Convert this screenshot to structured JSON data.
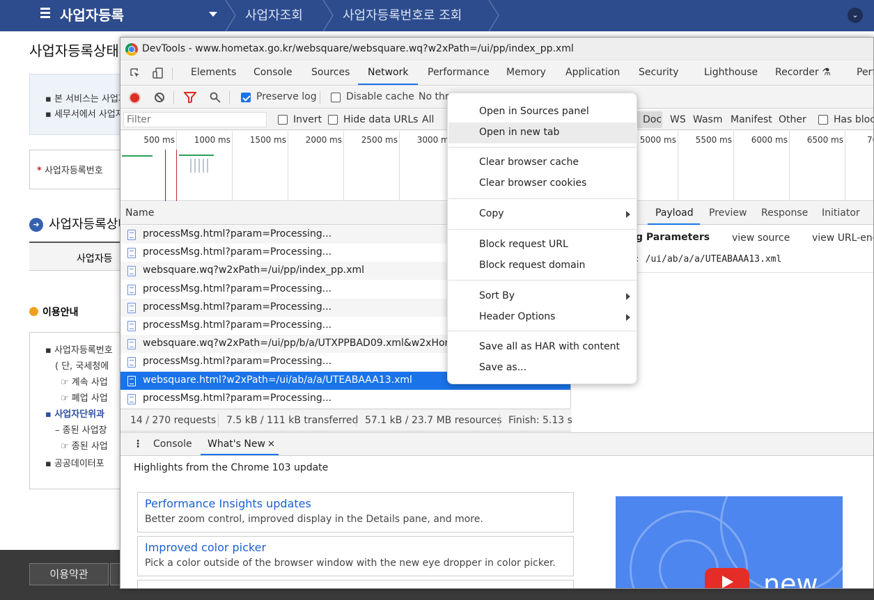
{
  "hometax": {
    "menu_title": "사업자등록",
    "breadcrumb": [
      "사업자조회",
      "사업자등록번호로 조회"
    ],
    "page_title": "사업자등록상태",
    "notice_lines": [
      "▪ 본 서비스는 사업자",
      "▪ 세무서에서 사업자"
    ],
    "reg_label": "사업자등록번호",
    "section_title": "사업자등록상태",
    "table_header": "사업자등",
    "guide_title": "이용안내",
    "guide_lines": [
      "▪ 사업자등록번호",
      "( 단, 국세청에",
      "☞ 계속 사업",
      "☞ 폐업 사업",
      "▪ 사업자단위과",
      "– 종된 사업장",
      "☞ 종된 사업",
      "▪ 공공데이터포"
    ],
    "footer_buttons": [
      "이용약관",
      ""
    ]
  },
  "devtools": {
    "window_title": "DevTools - www.hometax.go.kr/websquare/websquare.wq?w2xPath=/ui/pp/index_pp.xml",
    "panel_tabs": [
      "Elements",
      "Console",
      "Sources",
      "Network",
      "Performance",
      "Memory",
      "Application",
      "Security",
      "Lighthouse",
      "Recorder ⚗",
      "Perf"
    ],
    "active_tab": "Network",
    "toolbar": {
      "preserve_log": "Preserve log",
      "disable_cache": "Disable cache",
      "throttle": "No thr"
    },
    "filter": {
      "placeholder": "Filter",
      "invert": "Invert",
      "hide_data_urls": "Hide data URLs",
      "all": "All",
      "types": [
        "Doc",
        "WS",
        "Wasm",
        "Manifest",
        "Other"
      ],
      "has_blocked": "Has bloc"
    },
    "timeline_ticks": [
      "500 ms",
      "1000 ms",
      "1500 ms",
      "2000 ms",
      "2500 ms",
      "3000 ms",
      "5000 ms",
      "5500 ms",
      "6000 ms",
      "6500 ms",
      "70"
    ],
    "grid": {
      "name_header": "Name",
      "rows": [
        "processMsg.html?param=Processing...",
        "processMsg.html?param=Processing...",
        "websquare.wq?w2xPath=/ui/pp/index_pp.xml",
        "processMsg.html?param=Processing...",
        "processMsg.html?param=Processing...",
        "processMsg.html?param=Processing...",
        "websquare.wq?w2xPath=/ui/pp/b/a/UTXPPBAD09.xml&w2xHome",
        "processMsg.html?param=Processing...",
        "websquare.html?w2xPath=/ui/ab/a/a/UTEABAAA13.xml",
        "processMsg.html?param=Processing..."
      ],
      "selected_index": 8
    },
    "status": {
      "requests": "14 / 270 requests",
      "transferred": "7.5 kB / 111 kB transferred",
      "resources": "57.1 kB / 23.7 MB resources",
      "finish": "Finish: 5.13 s"
    },
    "details": {
      "tabs": [
        "Payload",
        "Preview",
        "Response",
        "Initiator"
      ],
      "active_tab": "Payload",
      "section_title": "g Parameters",
      "view_source": "view source",
      "view_url_encoded": "view URL-enc",
      "param_value": ": /ui/ab/a/a/UTEABAAA13.xml"
    },
    "drawer": {
      "tabs": [
        "Console",
        "What's New"
      ],
      "close_glyph": "✕",
      "headline": "Highlights from the Chrome 103 update",
      "cards": [
        {
          "title": "Performance Insights updates",
          "desc": "Better zoom control, improved display in the Details pane, and more."
        },
        {
          "title": "Improved color picker",
          "desc": "Pick a color outside of the browser window with the new eye dropper in color picker."
        }
      ],
      "promo_text": "new"
    }
  },
  "context_menu": {
    "items": [
      {
        "label": "Open in Sources panel"
      },
      {
        "label": "Open in new tab"
      },
      {
        "label": "Clear browser cache"
      },
      {
        "label": "Clear browser cookies"
      },
      {
        "label": "Copy"
      },
      {
        "label": "Block request URL"
      },
      {
        "label": "Block request domain"
      },
      {
        "label": "Sort By"
      },
      {
        "label": "Header Options"
      },
      {
        "label": "Save all as HAR with content"
      },
      {
        "label": "Save as..."
      }
    ],
    "highlighted": "Open in new tab"
  },
  "colors": {
    "accent": "#1a73e8",
    "hometax_bar": "#2d4c8e",
    "record_red": "#d93025"
  },
  "icons": [
    "hamburger-icon",
    "chevron-down-icon",
    "chrome-logo-icon",
    "inspect-icon",
    "device-toggle-icon",
    "record-icon",
    "clear-icon",
    "filter-icon",
    "search-icon",
    "document-icon",
    "submenu-arrow-icon",
    "close-icon",
    "more-icon"
  ]
}
